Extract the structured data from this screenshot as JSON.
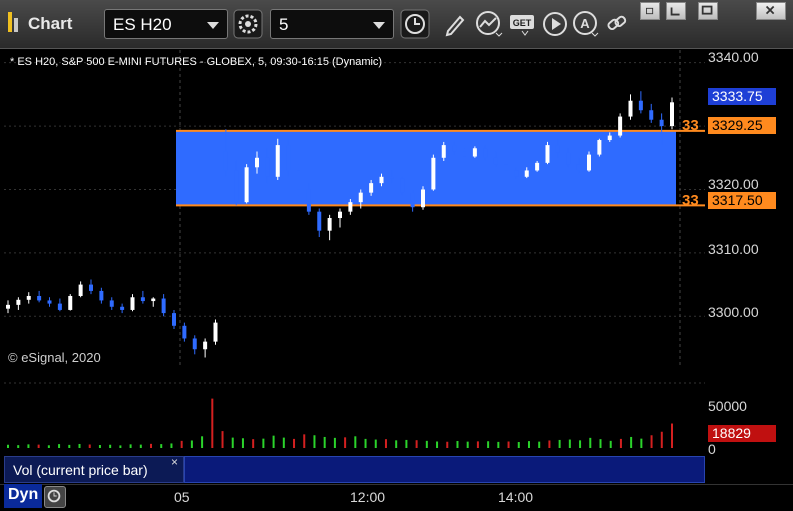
{
  "window": {
    "title": "Chart"
  },
  "toolbar": {
    "symbol_value": "ES H20",
    "interval_value": "5",
    "icons": [
      "settings-gear-icon",
      "clock-icon",
      "pencil-icon",
      "line-study-icon",
      "get-data-icon",
      "play-icon",
      "alert-icon",
      "link-icon"
    ]
  },
  "window_buttons": [
    "pin-icon",
    "restore-icon",
    "maximize-icon",
    "close-icon"
  ],
  "chart": {
    "info": "* ES H20, S&P 500 E-MINI FUTURES - GLOBEX, 5, 09:30-16:15 (Dynamic)",
    "copyright": "© eSignal, 2020",
    "price_ticks": [
      "3340.00",
      "3320.00",
      "3310.00",
      "3300.00"
    ],
    "last_price": "3333.75",
    "zone_upper": "3329.25",
    "zone_lower": "3317.50",
    "zone_upper_label": "33",
    "zone_lower_label": "33",
    "colors": {
      "zone": "#2f6bff",
      "zone_line": "#ff8a1e",
      "up": "#ffffff",
      "down": "#2f6bff",
      "last_tag": "#1e3fd6"
    }
  },
  "volume": {
    "label": "Vol (current price bar)",
    "close_glyph": "×",
    "tick": "50000",
    "zero": "0",
    "last_value": "18829",
    "colors": {
      "up": "#2bd42b",
      "down": "#d42020",
      "tag": "#c01010"
    }
  },
  "time_axis": {
    "ticks": [
      "05",
      "12:00",
      "14:00"
    ]
  },
  "footer": {
    "dyn_label": "Dyn"
  },
  "chart_data": {
    "type": "candlestick",
    "title": "",
    "y_range": [
      3292,
      3342
    ],
    "zone": {
      "upper": 3329.25,
      "lower": 3317.5
    },
    "candles": [
      [
        3301.2,
        3302.5,
        3300.5,
        3301.8
      ],
      [
        3301.8,
        3303.0,
        3301.0,
        3302.6
      ],
      [
        3302.6,
        3303.8,
        3302.0,
        3303.2
      ],
      [
        3303.2,
        3304.0,
        3302.2,
        3302.5
      ],
      [
        3302.5,
        3303.0,
        3301.5,
        3302.0
      ],
      [
        3302.0,
        3302.8,
        3300.8,
        3301.0
      ],
      [
        3301.0,
        3303.5,
        3300.9,
        3303.2
      ],
      [
        3303.2,
        3305.5,
        3303.0,
        3305.0
      ],
      [
        3305.0,
        3305.8,
        3303.5,
        3304.0
      ],
      [
        3304.0,
        3304.5,
        3302.0,
        3302.5
      ],
      [
        3302.5,
        3303.0,
        3301.0,
        3301.5
      ],
      [
        3301.5,
        3302.0,
        3300.5,
        3301.0
      ],
      [
        3301.0,
        3303.5,
        3300.8,
        3303.0
      ],
      [
        3303.0,
        3304.0,
        3302.0,
        3302.4
      ],
      [
        3302.4,
        3303.0,
        3301.5,
        3302.8
      ],
      [
        3302.8,
        3303.5,
        3300.0,
        3300.5
      ],
      [
        3300.5,
        3301.0,
        3298.0,
        3298.5
      ],
      [
        3298.5,
        3299.0,
        3296.0,
        3296.5
      ],
      [
        3296.5,
        3297.0,
        3294.0,
        3294.8
      ],
      [
        3294.8,
        3296.5,
        3293.5,
        3296.0
      ],
      [
        3296.0,
        3299.5,
        3295.5,
        3299.0
      ],
      [
        3326.0,
        3329.5,
        3322.0,
        3323.0
      ],
      [
        3323.0,
        3324.5,
        3317.5,
        3318.0
      ],
      [
        3318.0,
        3324.0,
        3317.8,
        3323.5
      ],
      [
        3323.5,
        3326.0,
        3322.5,
        3325.0
      ],
      [
        3325.0,
        3326.5,
        3321.0,
        3322.0
      ],
      [
        3322.0,
        3328.0,
        3321.5,
        3327.0
      ],
      [
        3327.0,
        3328.0,
        3322.0,
        3323.0
      ],
      [
        3323.0,
        3324.0,
        3319.0,
        3320.0
      ],
      [
        3320.0,
        3321.0,
        3316.0,
        3316.5
      ],
      [
        3316.5,
        3317.0,
        3312.5,
        3313.5
      ],
      [
        3313.5,
        3316.0,
        3312.0,
        3315.5
      ],
      [
        3315.5,
        3317.0,
        3314.0,
        3316.5
      ],
      [
        3316.5,
        3318.5,
        3316.0,
        3318.0
      ],
      [
        3318.0,
        3320.0,
        3317.0,
        3319.5
      ],
      [
        3319.5,
        3321.5,
        3319.0,
        3321.0
      ],
      [
        3321.0,
        3322.5,
        3320.5,
        3322.0
      ],
      [
        3322.0,
        3323.0,
        3321.0,
        3321.8
      ],
      [
        3321.8,
        3322.0,
        3319.0,
        3319.5
      ],
      [
        3319.5,
        3320.0,
        3316.5,
        3317.2
      ],
      [
        3317.2,
        3320.5,
        3316.8,
        3320.0
      ],
      [
        3320.0,
        3325.5,
        3319.8,
        3325.0
      ],
      [
        3325.0,
        3327.5,
        3324.5,
        3327.0
      ],
      [
        3327.0,
        3327.5,
        3325.5,
        3326.0
      ],
      [
        3326.0,
        3326.5,
        3324.8,
        3325.2
      ],
      [
        3325.2,
        3326.8,
        3325.0,
        3326.5
      ],
      [
        3326.5,
        3327.0,
        3324.5,
        3325.0
      ],
      [
        3325.0,
        3326.0,
        3323.5,
        3324.0
      ],
      [
        3324.0,
        3324.8,
        3322.5,
        3323.0
      ],
      [
        3323.0,
        3323.5,
        3321.5,
        3322.0
      ],
      [
        3322.0,
        3323.5,
        3321.8,
        3323.0
      ],
      [
        3323.0,
        3324.5,
        3322.8,
        3324.2
      ],
      [
        3324.2,
        3327.5,
        3324.0,
        3327.0
      ],
      [
        3327.0,
        3328.0,
        3325.0,
        3325.8
      ],
      [
        3325.8,
        3326.5,
        3323.5,
        3324.0
      ],
      [
        3324.0,
        3325.0,
        3322.5,
        3323.0
      ],
      [
        3323.0,
        3326.0,
        3322.8,
        3325.5
      ],
      [
        3325.5,
        3328.0,
        3325.2,
        3327.8
      ],
      [
        3327.8,
        3329.0,
        3327.5,
        3328.5
      ],
      [
        3328.5,
        3332.0,
        3328.2,
        3331.5
      ],
      [
        3331.5,
        3335.0,
        3331.0,
        3334.0
      ],
      [
        3334.0,
        3335.5,
        3332.0,
        3332.5
      ],
      [
        3332.5,
        3333.5,
        3330.5,
        3331.0
      ],
      [
        3331.0,
        3332.0,
        3327.0,
        3330.0
      ],
      [
        3330.0,
        3334.5,
        3329.5,
        3333.75
      ]
    ],
    "volume": [
      [
        2500,
        "up"
      ],
      [
        2200,
        "up"
      ],
      [
        2800,
        "up"
      ],
      [
        2600,
        "down"
      ],
      [
        2100,
        "up"
      ],
      [
        3000,
        "up"
      ],
      [
        2400,
        "up"
      ],
      [
        3100,
        "up"
      ],
      [
        2700,
        "down"
      ],
      [
        2300,
        "up"
      ],
      [
        2500,
        "up"
      ],
      [
        2000,
        "up"
      ],
      [
        2800,
        "up"
      ],
      [
        2600,
        "up"
      ],
      [
        3200,
        "down"
      ],
      [
        3000,
        "up"
      ],
      [
        3500,
        "up"
      ],
      [
        5500,
        "down"
      ],
      [
        5800,
        "up"
      ],
      [
        9000,
        "up"
      ],
      [
        38000,
        "down"
      ],
      [
        13000,
        "down"
      ],
      [
        8000,
        "up"
      ],
      [
        7500,
        "up"
      ],
      [
        6800,
        "down"
      ],
      [
        7200,
        "up"
      ],
      [
        9500,
        "up"
      ],
      [
        8000,
        "up"
      ],
      [
        7000,
        "down"
      ],
      [
        10500,
        "down"
      ],
      [
        9800,
        "up"
      ],
      [
        8500,
        "up"
      ],
      [
        7800,
        "up"
      ],
      [
        8200,
        "down"
      ],
      [
        9000,
        "up"
      ],
      [
        7000,
        "up"
      ],
      [
        6500,
        "up"
      ],
      [
        6800,
        "down"
      ],
      [
        5900,
        "up"
      ],
      [
        6200,
        "up"
      ],
      [
        6000,
        "down"
      ],
      [
        5500,
        "up"
      ],
      [
        5000,
        "up"
      ],
      [
        4800,
        "down"
      ],
      [
        5400,
        "up"
      ],
      [
        4900,
        "up"
      ],
      [
        5100,
        "down"
      ],
      [
        5200,
        "up"
      ],
      [
        4700,
        "up"
      ],
      [
        5000,
        "down"
      ],
      [
        4600,
        "up"
      ],
      [
        5300,
        "up"
      ],
      [
        4900,
        "up"
      ],
      [
        5800,
        "down"
      ],
      [
        6200,
        "up"
      ],
      [
        6500,
        "up"
      ],
      [
        5900,
        "up"
      ],
      [
        7800,
        "up"
      ],
      [
        6800,
        "up"
      ],
      [
        5500,
        "up"
      ],
      [
        7000,
        "down"
      ],
      [
        8500,
        "up"
      ],
      [
        7200,
        "up"
      ],
      [
        9800,
        "down"
      ],
      [
        12500,
        "down"
      ],
      [
        18829,
        "down"
      ]
    ]
  }
}
